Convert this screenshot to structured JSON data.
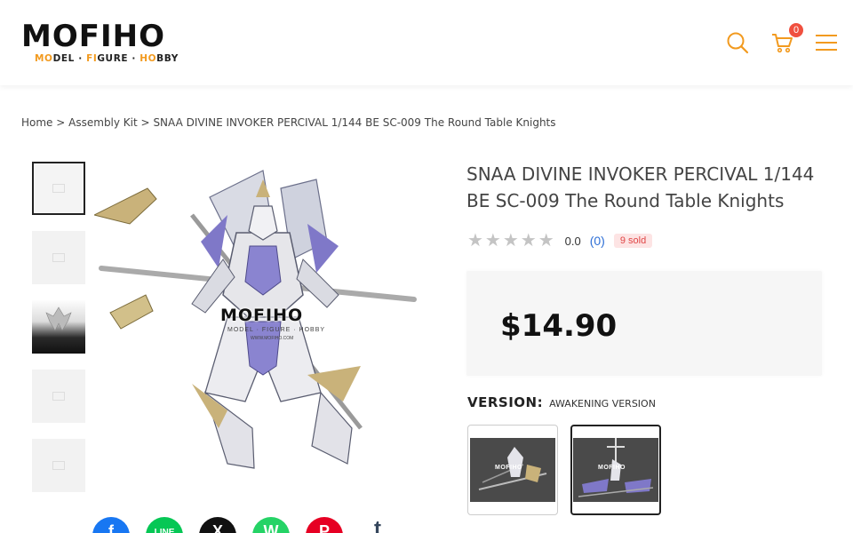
{
  "header": {
    "logo": {
      "main": "MOFIHO",
      "sub": "MODEL · FIGURE · HOBBY"
    },
    "cart_count": "0",
    "icons": [
      "search-icon",
      "cart-icon",
      "menu-icon"
    ]
  },
  "breadcrumb": {
    "home": "Home",
    "sep": ">",
    "category": "Assembly Kit",
    "current": "SNAA DIVINE INVOKER PERCIVAL 1/144 BE SC-009 The Round Table Knights"
  },
  "product": {
    "title": "SNAA DIVINE INVOKER PERCIVAL 1/144 BE SC-009 The Round Table Knights",
    "rating": {
      "stars": "★★★★★",
      "value": "0.0",
      "count": "(0)",
      "sold": "9 sold"
    },
    "price": "$14.90",
    "version": {
      "label": "VERSION:",
      "value": "AWAKENING VERSION"
    },
    "watermark": {
      "main": "MOFIHO",
      "sub": "MODEL · FIGURE · HOBBY",
      "url": "WWW.MOFIHO.COM"
    },
    "variant_watermark": "MOFIHO"
  },
  "share": {
    "facebook": "f",
    "line": "LINE",
    "x": "X",
    "whatsapp": "W",
    "pinterest": "P",
    "tumblr": "t"
  },
  "colors": {
    "accent_orange": "#f29a1f",
    "badge_red": "#f0503f",
    "link_blue": "#2e6fd6",
    "facebook": "#1877f2",
    "line": "#06c755",
    "x": "#111111",
    "whatsapp": "#25d366",
    "pinterest": "#e60023",
    "tumblr": "#35465c"
  }
}
